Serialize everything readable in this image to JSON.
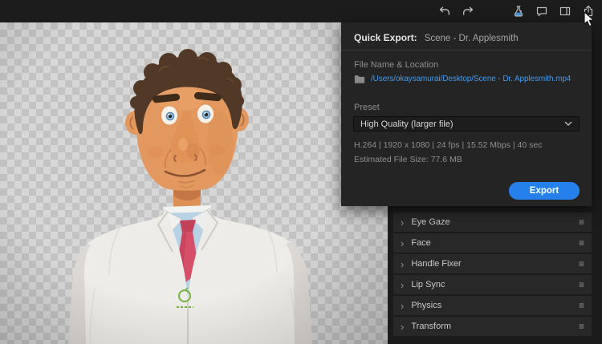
{
  "toolbar": {
    "icons": [
      "undo-icon",
      "redo-icon",
      "beaker-icon",
      "comment-icon",
      "panel-icon",
      "share-icon"
    ]
  },
  "export_panel": {
    "title": "Quick Export:",
    "scene_name": "Scene - Dr. Applesmith",
    "file_section_label": "File Name & Location",
    "file_path": "/Users/okaysamurai/Desktop/Scene - Dr. Applesmith.mp4",
    "preset_label": "Preset",
    "preset_value": "High Quality (larger file)",
    "format_summary": "H.264 | 1920 x 1080 | 24 fps | 15.52 Mbps | 40 sec",
    "estimated_size": "Estimated File Size: 77.6 MB",
    "export_button_label": "Export"
  },
  "properties_panel": {
    "sections": [
      {
        "label": "Eye Gaze"
      },
      {
        "label": "Face"
      },
      {
        "label": "Handle Fixer"
      },
      {
        "label": "Lip Sync"
      },
      {
        "label": "Physics"
      },
      {
        "label": "Transform"
      }
    ]
  },
  "glyphs": {
    "chevron": "›",
    "menu": "≡"
  },
  "colors": {
    "accent_blue": "#2680EB",
    "link_blue": "#3E9BF4",
    "panel_bg": "#242424",
    "tie_red": "#D64F68"
  }
}
